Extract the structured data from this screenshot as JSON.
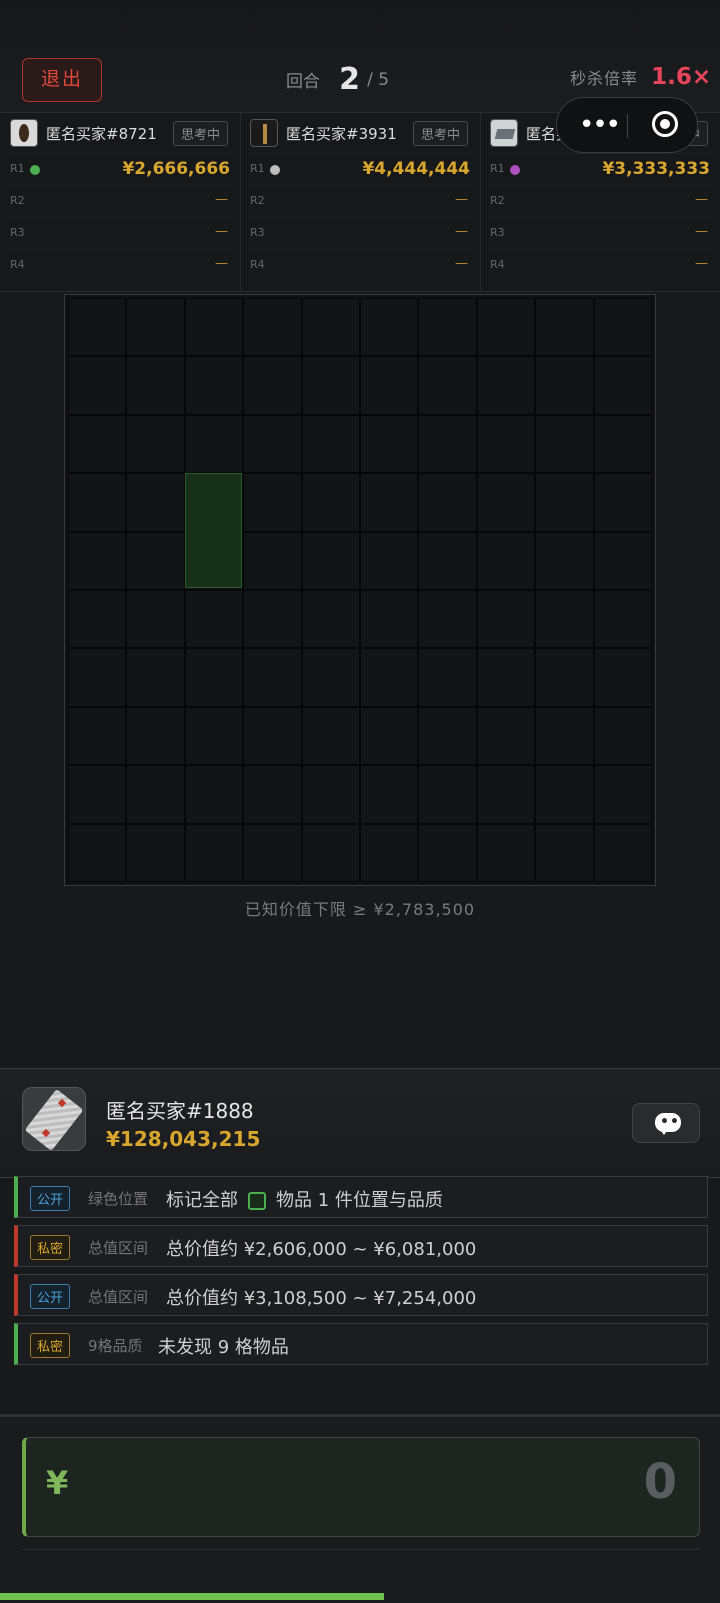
{
  "header": {
    "exit_label": "退出",
    "round_label": "回合",
    "round_current": "2",
    "round_total": "/ 5",
    "multiplier_label": "秒杀倍率",
    "multiplier_value": "1.6×"
  },
  "bidders": [
    {
      "name": "匿名买家#8721",
      "status": "思考中",
      "rows": [
        {
          "label": "R1",
          "amount": "¥2,666,666",
          "dot_color": "#4caf50"
        },
        {
          "label": "R2",
          "amount": "—"
        },
        {
          "label": "R3",
          "amount": "—"
        },
        {
          "label": "R4",
          "amount": "—"
        }
      ]
    },
    {
      "name": "匿名买家#3931",
      "status": "思考中",
      "rows": [
        {
          "label": "R1",
          "amount": "¥4,444,444",
          "dot_color": "#bdbdbd"
        },
        {
          "label": "R2",
          "amount": "—"
        },
        {
          "label": "R3",
          "amount": "—"
        },
        {
          "label": "R4",
          "amount": "—"
        }
      ]
    },
    {
      "name": "匿名买家#4592",
      "status": "思考中",
      "rows": [
        {
          "label": "R1",
          "amount": "¥3,333,333",
          "dot_color": "#b04fc0"
        },
        {
          "label": "R2",
          "amount": "—"
        },
        {
          "label": "R3",
          "amount": "—"
        },
        {
          "label": "R4",
          "amount": "—"
        }
      ]
    }
  ],
  "board": {
    "rows": 10,
    "cols": 10,
    "lower_bound_text": "已知价值下限 ≥ ¥2,783,500"
  },
  "player": {
    "name": "匿名买家#1888",
    "money": "¥128,043,215"
  },
  "clues": [
    {
      "tag": "公开",
      "category": "绿色位置",
      "text_pre": "标记全部",
      "text_post": "物品 1 件位置与品质"
    },
    {
      "tag": "私密",
      "category": "总值区间",
      "text": "总价值约 ¥2,606,000 ~ ¥6,081,000"
    },
    {
      "tag": "公开",
      "category": "总值区间",
      "text": "总价值约 ¥3,108,500 ~ ¥7,254,000"
    },
    {
      "tag": "私密",
      "category": "9格品质",
      "text": "未发现 9 格物品"
    }
  ],
  "bid": {
    "currency": "¥",
    "value": "0"
  },
  "colors": {
    "accent_gold": "#d9a62e",
    "accent_green": "#4caf50",
    "accent_red": "#e2473c",
    "multiplier": "#e8455a"
  },
  "icons": [
    "more-dots-icon",
    "target-icon",
    "chat-icon"
  ]
}
